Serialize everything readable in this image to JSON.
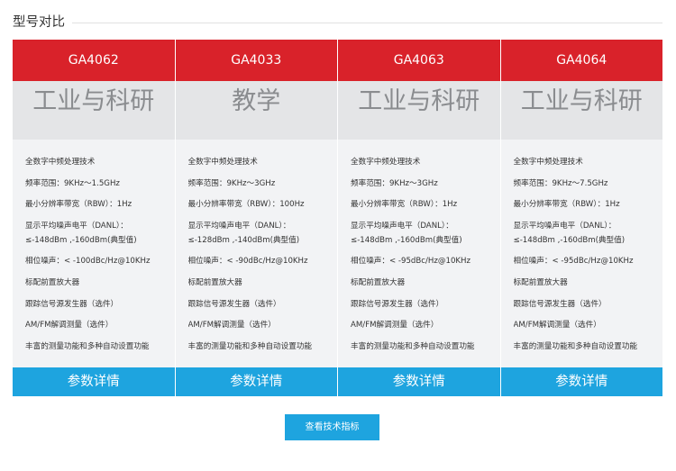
{
  "section_title": "型号对比",
  "colors": {
    "brand_red": "#d9222a",
    "band_gray": "#e4e5e7",
    "spec_bg": "#f2f3f5",
    "category_text": "#8a8c8f",
    "button_blue": "#1ea4df"
  },
  "models": [
    {
      "name": "GA4062",
      "category": "工业与科研",
      "specs": [
        "全数字中频处理技术",
        "频率范围：9KHz～1.5GHz",
        "最小分辨率带宽（RBW）：1Hz",
        "显示平均噪声电平（DANL）：",
        "≤-148dBm ,-160dBm(典型值)",
        "相位噪声：< -100dBc/Hz@10KHz",
        "标配前置放大器",
        "跟踪信号源发生器（选件）",
        "AM/FM解调测量（选件）",
        "丰富的测量功能和多种自动设置功能"
      ],
      "details_button": "参数详情"
    },
    {
      "name": "GA4033",
      "category": "教学",
      "specs": [
        "全数字中频处理技术",
        "频率范围：9KHz～3GHz",
        "最小分辨率带宽（RBW）：100Hz",
        "显示平均噪声电平（DANL）：",
        "≤-128dBm ,-140dBm(典型值)",
        "相位噪声：< -90dBc/Hz@10KHz",
        "标配前置放大器",
        "跟踪信号源发生器（选件）",
        "AM/FM解调测量（选件）",
        "丰富的测量功能和多种自动设置功能"
      ],
      "details_button": "参数详情"
    },
    {
      "name": "GA4063",
      "category": "工业与科研",
      "specs": [
        "全数字中频处理技术",
        "频率范围：9KHz～3GHz",
        "最小分辨率带宽（RBW）：1Hz",
        "显示平均噪声电平（DANL）：",
        "≤-148dBm ,-160dBm(典型值)",
        "相位噪声：< -95dBc/Hz@10KHz",
        "标配前置放大器",
        "跟踪信号源发生器（选件）",
        "AM/FM解调测量（选件）",
        "丰富的测量功能和多种自动设置功能"
      ],
      "details_button": "参数详情"
    },
    {
      "name": "GA4064",
      "category": "工业与科研",
      "specs": [
        "全数字中频处理技术",
        "频率范围：9KHz～7.5GHz",
        "最小分辨率带宽（RBW）：1Hz",
        "显示平均噪声电平（DANL）：",
        "≤-148dBm ,-160dBm(典型值)",
        "相位噪声：< -95dBc/Hz@10KHz",
        "标配前置放大器",
        "跟踪信号源发生器（选件）",
        "AM/FM解调测量（选件）",
        "丰富的测量功能和多种自动设置功能"
      ],
      "details_button": "参数详情"
    }
  ],
  "tech_specs_button": "查看技术指标"
}
